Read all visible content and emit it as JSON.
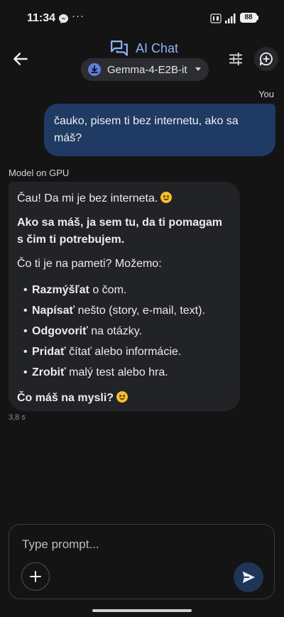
{
  "status_bar": {
    "time": "11:34",
    "more": "···",
    "battery": "88"
  },
  "header": {
    "title": "AI Chat",
    "model_name": "Gemma-4-E2B-it"
  },
  "chat": {
    "user_label": "You",
    "user_message": "čauko, pisem ti bez internetu, ako sa máš?",
    "model_label": "Model on GPU",
    "response": {
      "line1": "Čau! Da mi je bez interneta.",
      "line2": "Ako sa máš, ja sem tu, da ti pomagam s čim ti potrebujem.",
      "line3": "Čo ti je na pameti? Možemo:",
      "list": [
        {
          "bold": "Razmýšľat",
          "rest": " o čom."
        },
        {
          "bold": "Napísať",
          "rest": " nešto (story, e-mail, text)."
        },
        {
          "bold": "Odgovoriť",
          "rest": " na otázky."
        },
        {
          "bold": "Pridať",
          "rest": " čítať alebo informácie."
        },
        {
          "bold": "Zrobiť",
          "rest": " malý test alebo hra."
        }
      ],
      "line4": "Čo máš na mysli?"
    },
    "latency": "3,8 s"
  },
  "prompt": {
    "placeholder": "Type prompt..."
  },
  "colors": {
    "background": "#141414",
    "accent": "#8fb4ff",
    "user_bubble": "#1f3a63",
    "model_bubble": "#222326"
  },
  "icons": [
    "messenger-icon",
    "back-arrow-icon",
    "chat-bubbles-icon",
    "model-icon",
    "tune-icon",
    "new-chat-icon",
    "plus-icon",
    "send-icon"
  ]
}
